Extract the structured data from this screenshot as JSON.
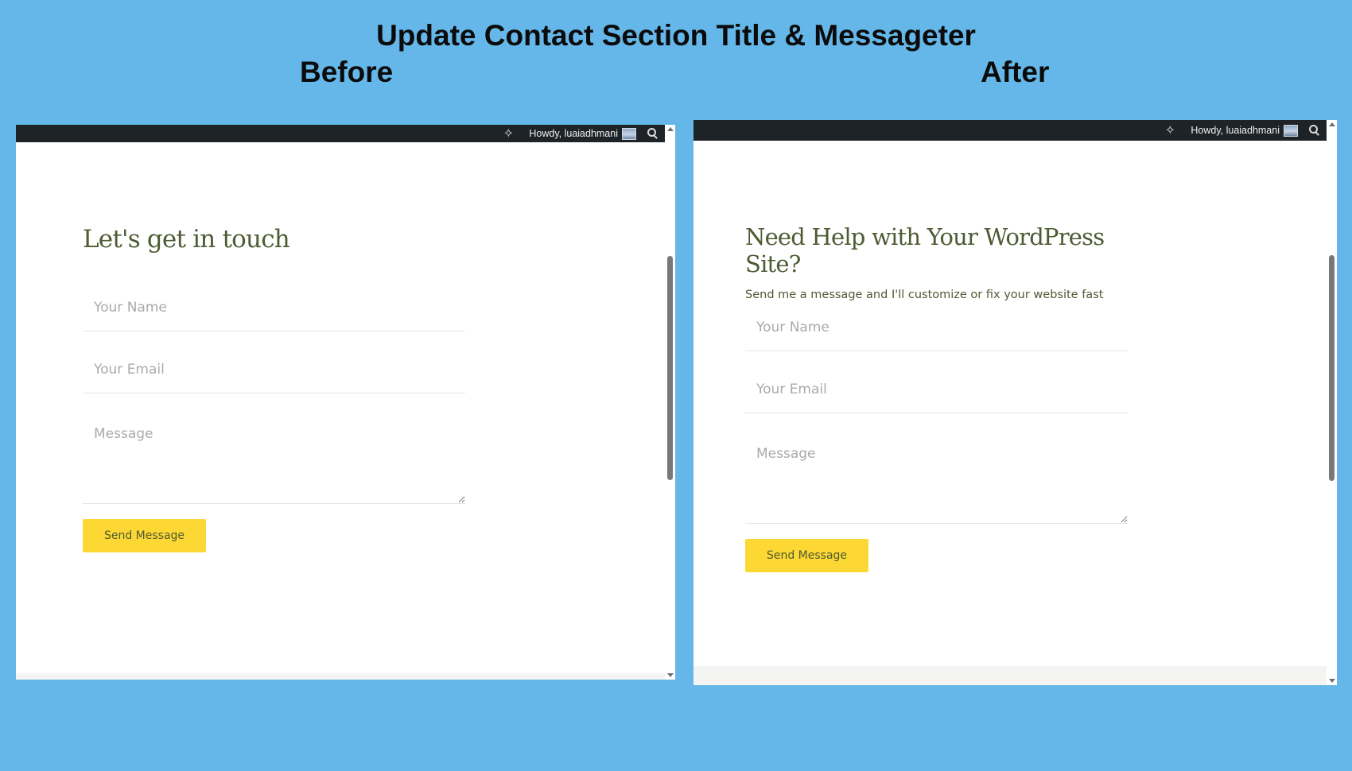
{
  "headline": "Update Contact Section Title & Messageter",
  "before": {
    "label": "Before",
    "adminbar": {
      "howdy": "Howdy, luaiadhmani"
    },
    "contact": {
      "title": "Let's get in touch",
      "name_placeholder": "Your Name",
      "email_placeholder": "Your Email",
      "message_placeholder": "Message",
      "button_label": "Send Message"
    }
  },
  "after": {
    "label": "After",
    "adminbar": {
      "howdy": "Howdy, luaiadhmani"
    },
    "contact": {
      "title": "Need Help with Your WordPress Site?",
      "subtitle": "Send me a message and I'll customize or fix your website fast",
      "name_placeholder": "Your Name",
      "email_placeholder": "Your Email",
      "message_placeholder": "Message",
      "button_label": "Send Message"
    }
  },
  "icons": [
    "ai-sparkle-icon",
    "avatar",
    "search-icon",
    "scroll-up-icon",
    "scroll-down-icon"
  ],
  "colors": {
    "background": "#65b7e9",
    "adminbar": "#1d2327",
    "heading": "#4e5b33",
    "button": "#fdd733"
  }
}
